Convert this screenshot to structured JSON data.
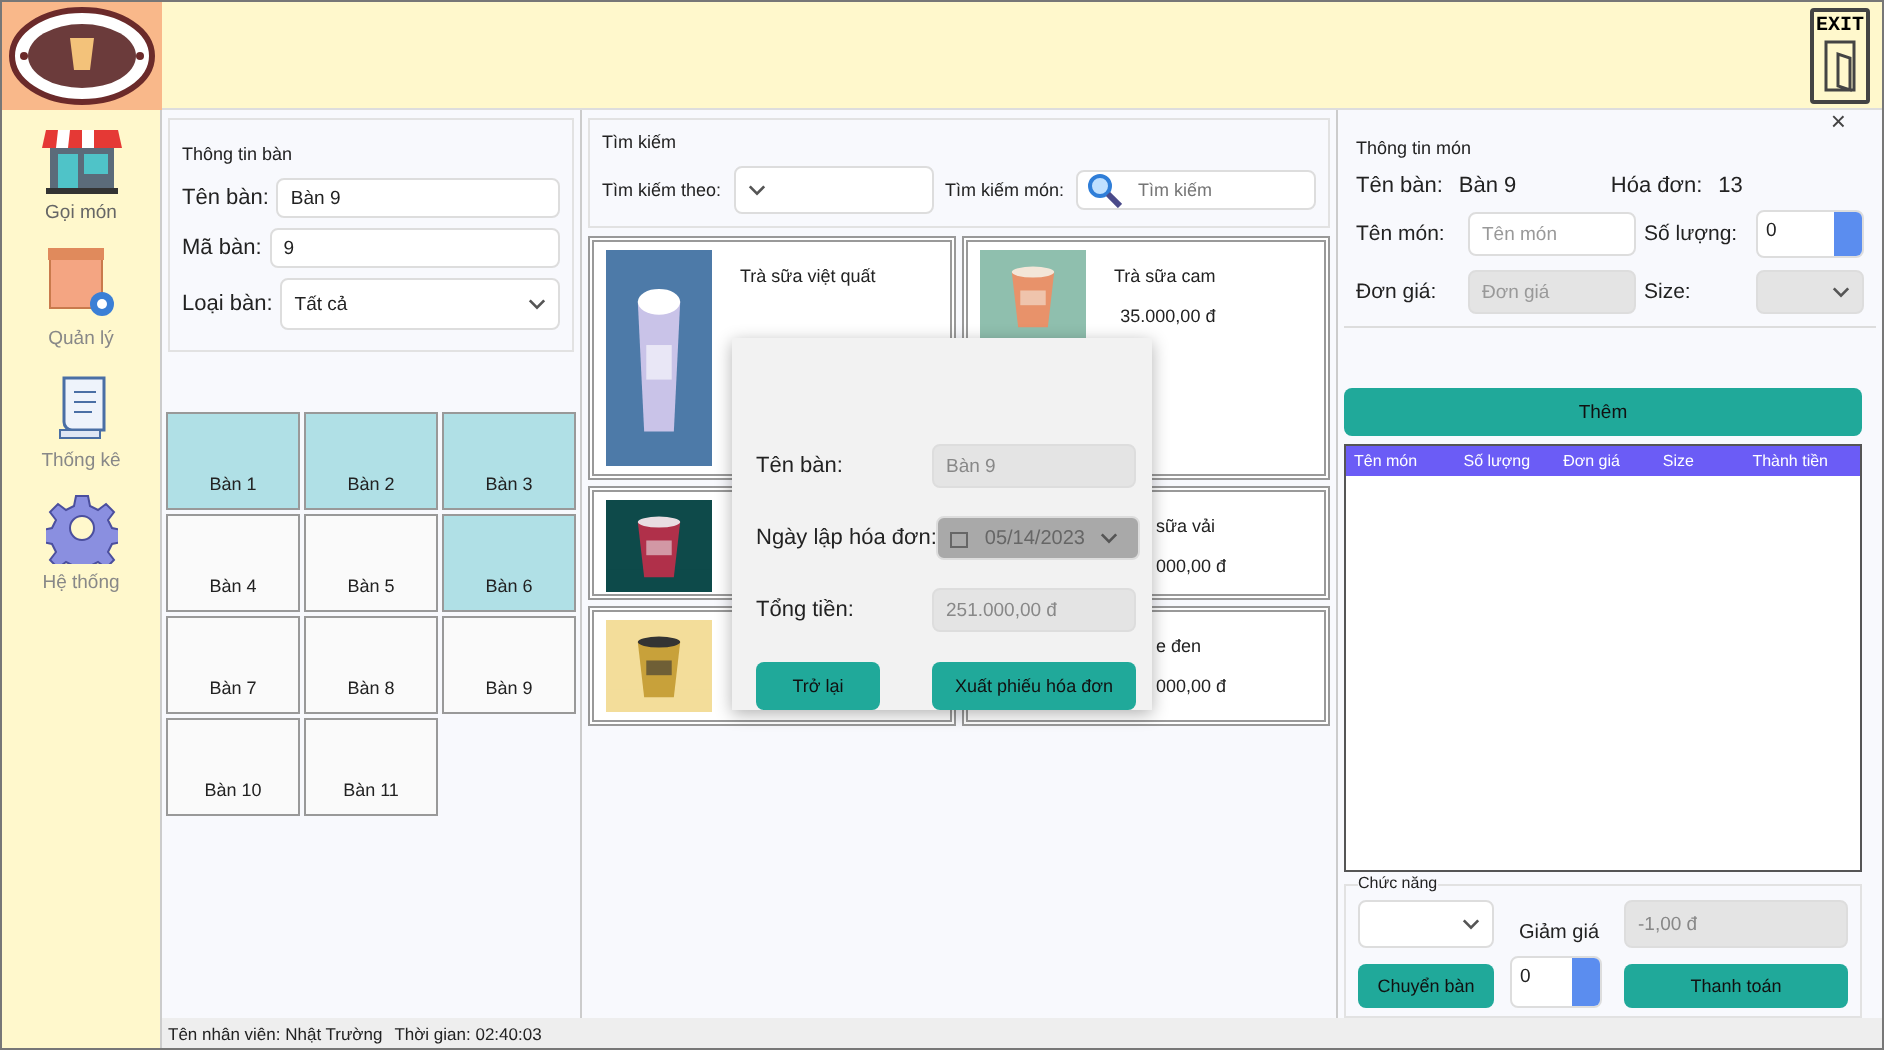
{
  "sidebar": {
    "items": [
      {
        "label": "Gọi món",
        "kind": "shop",
        "selected": true
      },
      {
        "label": "Quản lý",
        "kind": "box",
        "selected": false
      },
      {
        "label": "Thống kê",
        "kind": "scroll",
        "selected": false
      },
      {
        "label": "Hệ thống",
        "kind": "gear",
        "selected": false
      }
    ]
  },
  "exit_button": {
    "label": "EXIT"
  },
  "close_button": "×",
  "table_info": {
    "title": "Thông tin bàn",
    "fields": [
      {
        "label": "Tên bàn:",
        "value": "Bàn 9"
      },
      {
        "label": "Mã bàn:",
        "value": "9"
      }
    ],
    "type_label": "Loại bàn:",
    "type_value": "Tất cả"
  },
  "tables": [
    {
      "label": "Bàn 1",
      "selected": true
    },
    {
      "label": "Bàn 2",
      "selected": true
    },
    {
      "label": "Bàn 3",
      "selected": true
    },
    {
      "label": "Bàn 4",
      "selected": false
    },
    {
      "label": "Bàn 5",
      "selected": false
    },
    {
      "label": "Bàn 6",
      "selected": true
    },
    {
      "label": "Bàn 7",
      "selected": false
    },
    {
      "label": "Bàn 8",
      "selected": false
    },
    {
      "label": "Bàn 9",
      "selected": false
    },
    {
      "label": "Bàn 10",
      "selected": false
    },
    {
      "label": "Bàn 11",
      "selected": false
    }
  ],
  "search": {
    "title": "Tìm kiếm",
    "by_label": "Tìm kiếm theo:",
    "item_label": "Tìm kiếm món:",
    "placeholder": "Tìm kiếm"
  },
  "products": [
    {
      "kind": "full",
      "name": "Trà sữa việt quất"
    },
    {
      "kind": "full",
      "name": "Trà sữa cam",
      "price": "35.000,00 đ"
    },
    {
      "kind": "image_only"
    },
    {
      "kind": "covered",
      "name": "sữa vải",
      "price": "000,00 đ"
    },
    {
      "kind": "image_only"
    },
    {
      "kind": "covered",
      "name": "e đen",
      "price": "000,00 đ"
    }
  ],
  "dialog": {
    "table_label": "Tên bàn:",
    "table_value": "Bàn 9",
    "date_label": "Ngày lập hóa đơn:",
    "date_value": "05/14/2023",
    "total_label": "Tổng tiền:",
    "total_value": "251.000,00 đ",
    "buttons": [
      "Trở lại",
      "Xuất phiếu hóa đơn"
    ]
  },
  "item_info": {
    "title": "Thông tin món",
    "table_label": "Tên bàn:",
    "table_value": "Bàn 9",
    "bill_label": "Hóa đơn:",
    "bill_value": "13",
    "name_label": "Tên món:",
    "name_placeholder": "Tên món",
    "qty_label": "Số lượng:",
    "qty_value": "0",
    "price_label": "Đơn giá:",
    "price_placeholder": "Đơn giá",
    "size_label": "Size:"
  },
  "add_button": "Thêm",
  "order_table": {
    "columns": [
      "Tên món",
      "Số lượng",
      "Đơn giá",
      "Size",
      "Thành tiền"
    ]
  },
  "functions": {
    "title": "Chức năng",
    "discount_label": "Giảm giá",
    "discount_value": "0",
    "amount_value": "-1,00 đ",
    "move_button": "Chuyển bàn",
    "pay_button": "Thanh toán"
  },
  "status_bar": {
    "employee": "Tên nhân viên: Nhật Trường",
    "time": "Thời gian: 02:40:03"
  }
}
